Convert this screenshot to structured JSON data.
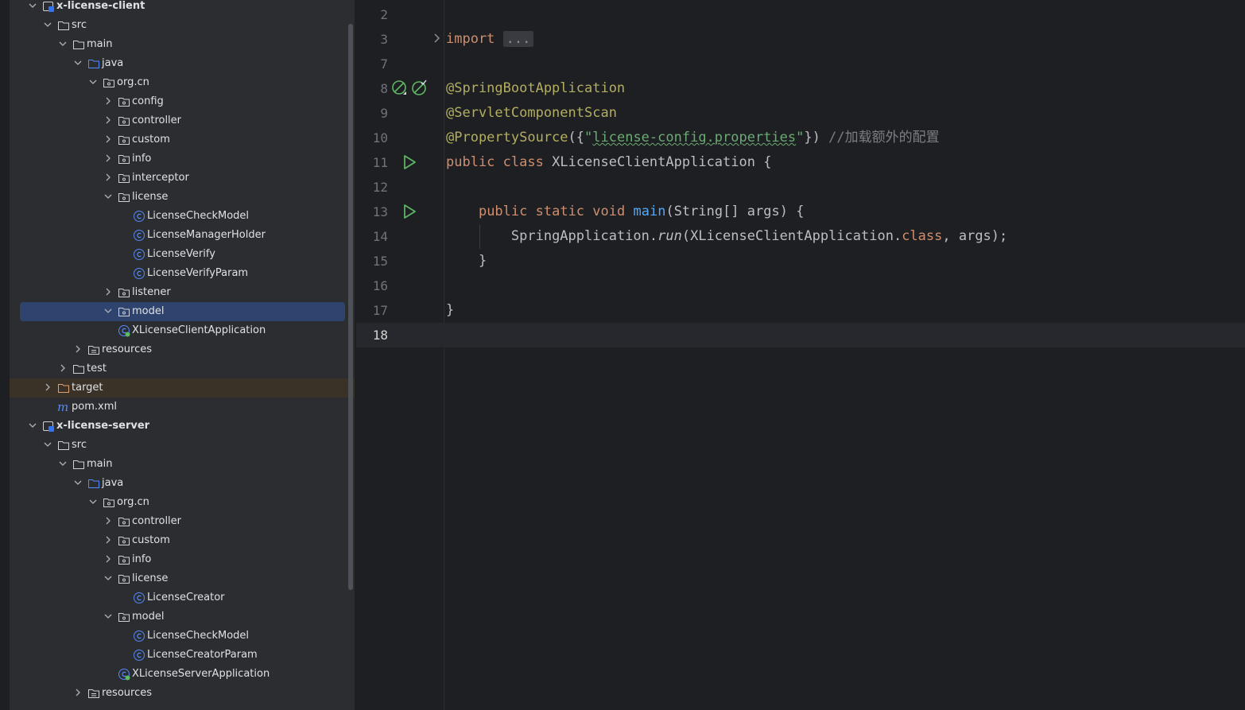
{
  "tree": [
    {
      "indent": 0,
      "chev": "down",
      "icon": "module",
      "label": "x-license-client",
      "bold": true
    },
    {
      "indent": 1,
      "chev": "down",
      "icon": "folder",
      "label": "src"
    },
    {
      "indent": 2,
      "chev": "down",
      "icon": "folder",
      "label": "main"
    },
    {
      "indent": 3,
      "chev": "down",
      "icon": "folder-source",
      "label": "java"
    },
    {
      "indent": 4,
      "chev": "down",
      "icon": "package",
      "label": "org.cn"
    },
    {
      "indent": 5,
      "chev": "right",
      "icon": "package",
      "label": "config"
    },
    {
      "indent": 5,
      "chev": "right",
      "icon": "package",
      "label": "controller"
    },
    {
      "indent": 5,
      "chev": "right",
      "icon": "package",
      "label": "custom"
    },
    {
      "indent": 5,
      "chev": "right",
      "icon": "package",
      "label": "info"
    },
    {
      "indent": 5,
      "chev": "right",
      "icon": "package",
      "label": "interceptor"
    },
    {
      "indent": 5,
      "chev": "down",
      "icon": "package",
      "label": "license"
    },
    {
      "indent": 6,
      "chev": "none",
      "icon": "class",
      "label": "LicenseCheckModel"
    },
    {
      "indent": 6,
      "chev": "none",
      "icon": "class",
      "label": "LicenseManagerHolder"
    },
    {
      "indent": 6,
      "chev": "none",
      "icon": "class",
      "label": "LicenseVerify"
    },
    {
      "indent": 6,
      "chev": "none",
      "icon": "class",
      "label": "LicenseVerifyParam"
    },
    {
      "indent": 5,
      "chev": "right",
      "icon": "package",
      "label": "listener"
    },
    {
      "indent": 5,
      "chev": "down",
      "icon": "package",
      "label": "model",
      "selected": true
    },
    {
      "indent": 5,
      "chev": "none",
      "icon": "spring-class",
      "label": "XLicenseClientApplication"
    },
    {
      "indent": 3,
      "chev": "right",
      "icon": "folder-resources",
      "label": "resources"
    },
    {
      "indent": 2,
      "chev": "right",
      "icon": "folder",
      "label": "test"
    },
    {
      "indent": 1,
      "chev": "right",
      "icon": "folder-excluded",
      "label": "target",
      "target": true
    },
    {
      "indent": 1,
      "chev": "none",
      "icon": "maven",
      "label": "pom.xml"
    },
    {
      "indent": 0,
      "chev": "down",
      "icon": "module",
      "label": "x-license-server",
      "bold": true
    },
    {
      "indent": 1,
      "chev": "down",
      "icon": "folder",
      "label": "src"
    },
    {
      "indent": 2,
      "chev": "down",
      "icon": "folder",
      "label": "main"
    },
    {
      "indent": 3,
      "chev": "down",
      "icon": "folder-source",
      "label": "java"
    },
    {
      "indent": 4,
      "chev": "down",
      "icon": "package",
      "label": "org.cn"
    },
    {
      "indent": 5,
      "chev": "right",
      "icon": "package",
      "label": "controller"
    },
    {
      "indent": 5,
      "chev": "right",
      "icon": "package",
      "label": "custom"
    },
    {
      "indent": 5,
      "chev": "right",
      "icon": "package",
      "label": "info"
    },
    {
      "indent": 5,
      "chev": "down",
      "icon": "package",
      "label": "license"
    },
    {
      "indent": 6,
      "chev": "none",
      "icon": "class",
      "label": "LicenseCreator"
    },
    {
      "indent": 5,
      "chev": "down",
      "icon": "package",
      "label": "model"
    },
    {
      "indent": 6,
      "chev": "none",
      "icon": "class",
      "label": "LicenseCheckModel"
    },
    {
      "indent": 6,
      "chev": "none",
      "icon": "class",
      "label": "LicenseCreatorParam"
    },
    {
      "indent": 5,
      "chev": "none",
      "icon": "spring-class",
      "label": "XLicenseServerApplication"
    },
    {
      "indent": 3,
      "chev": "right",
      "icon": "folder-resources",
      "label": "resources"
    }
  ],
  "editor": {
    "line_numbers": [
      "2",
      "3",
      "7",
      "8",
      "9",
      "10",
      "11",
      "12",
      "13",
      "14",
      "15",
      "16",
      "17",
      "18"
    ],
    "current_line": "18",
    "code": {
      "import_kw": "import",
      "import_fold": "...",
      "ann1": "@SpringBootApplication",
      "ann2": "@ServletComponentScan",
      "ann3_prefix": "@PropertySource",
      "ann3_open": "({",
      "ann3_q1": "\"",
      "ann3_str": "license-config.properties",
      "ann3_q2": "\"",
      "ann3_close": "})",
      "ann3_comment": "//加载额外的配置",
      "class_public": "public",
      "class_kw": "class",
      "class_name": "XLicenseClientApplication {",
      "main_public": "public",
      "main_static": "static",
      "main_void": "void",
      "main_name": "main",
      "main_params": "(String[] args) {",
      "run_obj": "SpringApplication.",
      "run_fn": "run",
      "run_arg1": "(XLicenseClientApplication.",
      "run_class": "class",
      "run_arg2": ", args);",
      "close_inner": "}",
      "close_outer": "}"
    }
  },
  "colors": {
    "keyword": "#cf8e6d",
    "annotation": "#b3ae60",
    "string": "#6aab73",
    "comment": "#7a7e85",
    "function": "#56a8f5",
    "selection": "#2e436e"
  }
}
